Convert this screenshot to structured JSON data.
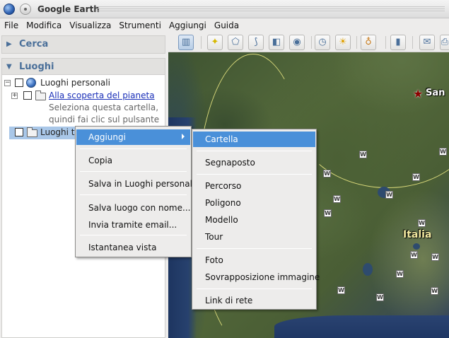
{
  "window": {
    "title": "Google Earth"
  },
  "menubar": [
    "File",
    "Modifica",
    "Visualizza",
    "Strumenti",
    "Aggiungi",
    "Guida"
  ],
  "sidebar": {
    "search_header": "Cerca",
    "places_header": "Luoghi",
    "tree": {
      "root": "Luoghi personali",
      "child_link": "Alla scoperta del pianeta",
      "child_desc_line1": "Seleziona questa cartella,",
      "child_desc_line2": "quindi fai clic sul pulsante",
      "temp": "Luoghi te"
    }
  },
  "map": {
    "labels": {
      "country": "Italia",
      "city": "San"
    }
  },
  "context_menu": {
    "items": [
      "Aggiungi",
      "Copia",
      "Salva in Luoghi personali",
      "Salva luogo con nome...",
      "Invia tramite email...",
      "Istantanea vista"
    ]
  },
  "submenu": {
    "items": [
      "Cartella",
      "Segnaposto",
      "Percorso",
      "Poligono",
      "Modello",
      "Tour",
      "Foto",
      "Sovrapposizione immagine",
      "Link di rete"
    ]
  },
  "colors": {
    "accent": "#4a90d9",
    "header_text": "#4a6f99",
    "link": "#1a2fb8"
  },
  "icons": {
    "toolbar": [
      "sidebar-toggle-icon",
      "placemark-icon",
      "polygon-icon",
      "path-icon",
      "image-overlay-icon",
      "record-tour-icon",
      "historical-imagery-icon",
      "sunlight-icon",
      "planet-icon",
      "ruler-icon",
      "email-icon",
      "print-icon"
    ]
  }
}
